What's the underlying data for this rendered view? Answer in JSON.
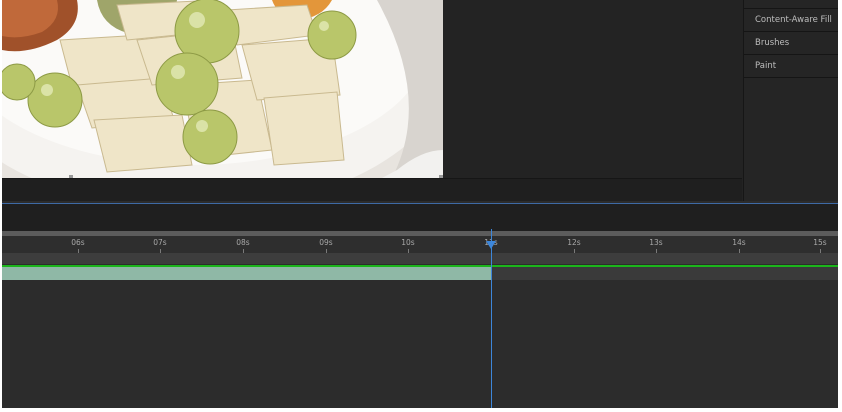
{
  "panel": {
    "items": [
      "Content-Aware Fill",
      "Brushes",
      "Paint"
    ]
  },
  "timeline": {
    "ticks": [
      "06s",
      "07s",
      "08s",
      "09s",
      "10s",
      "11s",
      "12s",
      "13s",
      "14s",
      "15s"
    ]
  },
  "colors": {
    "accent": "#3d86d9",
    "layer_bar": "#8fb8a6",
    "work_area": "#1bb51b",
    "background": "#232323"
  },
  "icons": [
    "playhead-icon"
  ]
}
